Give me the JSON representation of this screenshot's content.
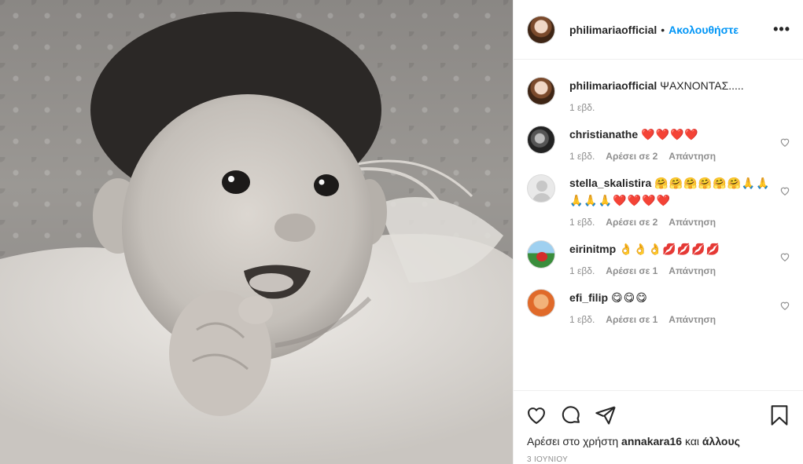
{
  "header": {
    "username": "philimariaofficial",
    "separator": "•",
    "follow_label": "Ακολουθήστε",
    "more_icon": "more-horizontal-icon"
  },
  "caption": {
    "username": "philimariaofficial",
    "text": "ΨΑΧΝΟΝΤΑΣ.....",
    "time": "1 εβδ."
  },
  "comments": [
    {
      "username": "christianathe",
      "text": "❤️❤️❤️❤️",
      "time": "1 εβδ.",
      "likes": "Αρέσει σε 2",
      "reply": "Απάντηση"
    },
    {
      "username": "stella_skalistira",
      "text": "🤗🤗🤗🤗🤗🤗🙏🙏🙏🙏🙏❤️❤️❤️❤️",
      "time": "1 εβδ.",
      "likes": "Αρέσει σε 2",
      "reply": "Απάντηση"
    },
    {
      "username": "eirinitmp",
      "text": "👌👌👌💋💋💋💋",
      "time": "1 εβδ.",
      "likes": "Αρέσει σε 1",
      "reply": "Απάντηση"
    },
    {
      "username": "efi_filip",
      "text": "😋😋😋",
      "time": "1 εβδ.",
      "likes": "Αρέσει σε 1",
      "reply": "Απάντηση"
    }
  ],
  "likes": {
    "prefix": "Αρέσει στο χρήστη",
    "user": "annakara16",
    "conj": "και",
    "others": "άλλους"
  },
  "date": "3 ΙΟΥΝΙΟΥ",
  "icons": {
    "like": "heart-icon",
    "comment": "comment-icon",
    "share": "paper-plane-icon",
    "save": "bookmark-icon"
  }
}
